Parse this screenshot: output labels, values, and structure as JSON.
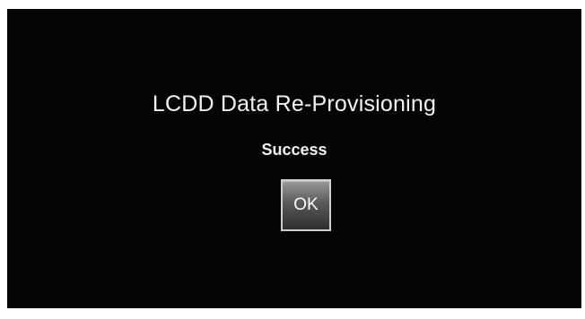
{
  "dialog": {
    "title": "LCDD Data Re-Provisioning",
    "message": "Success",
    "ok_label": "OK"
  },
  "colors": {
    "background": "#050505",
    "text": "#f2f2f2",
    "button_border": "#cfcfcf"
  }
}
